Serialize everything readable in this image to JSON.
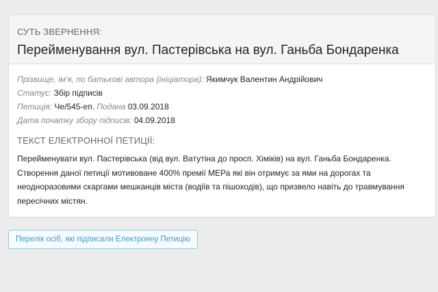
{
  "petition": {
    "heading_label": "СУТЬ ЗВЕРНЕННЯ:",
    "title": "Перейменування вул. Пастерівська на вул. Ганьба Бондаренка",
    "author_label": "Прізвище, ім'я, по батькові автора (ініціатора):",
    "author_value": "Якимчук Валентин Андрійович",
    "status_label": "Статус:",
    "status_value": "Збір підписів",
    "petition_label": "Петиція:",
    "petition_value": "Че/545-еп.",
    "submitted_label": "Подана",
    "submitted_value": "03.09.2018",
    "start_label": "Дата початку збору підписів:",
    "start_value": "04.09.2018",
    "text_section_title": "ТЕКСТ ЕЛЕКТРОННОЇ ПЕТИЦІЇ:",
    "text_paragraph_1": "Перейменувати вул. Пастерівська (від вул. Ватутіна до просп. Хіміків) на вул. Ганьба Бондаренка.",
    "text_paragraph_2": "Створення даної петиції мотивоване 400% премії МЕРа які він отримує за ями на дорогах та неодноразовими скаргами мешканців міста (водіїв та пішоходів), що призвело навіть до травмування пересічних містян."
  },
  "actions": {
    "signers_button_label": "Перелік осіб, які підписали Електронну Петицію"
  }
}
